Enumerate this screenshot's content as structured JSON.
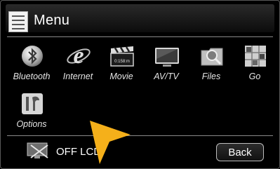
{
  "header": {
    "title": "Menu",
    "icon": "menu-list-icon"
  },
  "apps": [
    {
      "label": "Bluetooth",
      "icon": "bluetooth-icon"
    },
    {
      "label": "Internet",
      "icon": "internet-explorer-icon"
    },
    {
      "label": "Movie",
      "icon": "movie-clapper-icon"
    },
    {
      "label": "AV/TV",
      "icon": "tv-icon"
    },
    {
      "label": "Files",
      "icon": "folder-magnifier-icon"
    },
    {
      "label": "Go",
      "icon": "navigation-go-icon"
    },
    {
      "label": "Options",
      "icon": "wrench-options-icon"
    }
  ],
  "footer": {
    "lcd_label": "OFF LCD",
    "back_label": "Back"
  },
  "colors": {
    "background": "#000000",
    "cursor": "#f5b01a",
    "text": "#ffffff"
  }
}
